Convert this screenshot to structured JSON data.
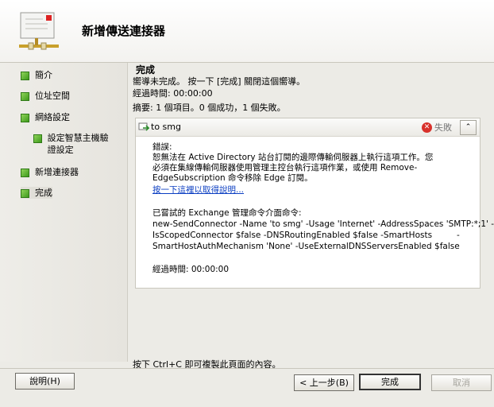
{
  "header": {
    "title": "新增傳送連接器"
  },
  "sidebar": {
    "items": [
      {
        "label": "簡介"
      },
      {
        "label": "位址空間"
      },
      {
        "label": "網絡設定"
      },
      {
        "label": "設定智慧主機驗證設定"
      },
      {
        "label": "新增連接器"
      },
      {
        "label": "完成"
      }
    ]
  },
  "main": {
    "title": "完成",
    "status": "嚮導未完成。 按一下 [完成] 關閉這個嚮導。",
    "elapsed": "經過時間: 00:00:00",
    "summary": "摘要: 1 個項目。0 個成功，1 個失敗。"
  },
  "task": {
    "name": "to smg",
    "status": "失敗",
    "error_label": "錯誤:",
    "error_lines": [
      "恕無法在 Active Directory 站台訂閱的邊際傳輸伺服器上執行這項工作。您",
      "必須在集線傳輸伺服器使用管理主控台執行這項作業，或使用 Remove-",
      "EdgeSubscription 命令移除 Edge 訂閱。"
    ],
    "help_link": "按一下這裡以取得說明...",
    "cmd_label": "已嘗試的 Exchange 管理命令介面命令:",
    "cmd_lines": [
      "new-SendConnector -Name 'to smg' -Usage 'Internet' -AddressSpaces 'SMTP:*;1' -",
      "IsScopedConnector $false -DNSRoutingEnabled $false -SmartHosts",
      "SmartHostAuthMechanism 'None' -UseExternalDNSServersEnabled $false"
    ],
    "cmd_dash": "-",
    "elapsed": "經過時間: 00:00:00"
  },
  "footer": {
    "hint": "按下 Ctrl+C 即可複製此頁面的內容。",
    "help_button": "說明(H)",
    "back_button": "< 上一步(B)",
    "finish_button": "完成",
    "cancel_button": "取消"
  }
}
